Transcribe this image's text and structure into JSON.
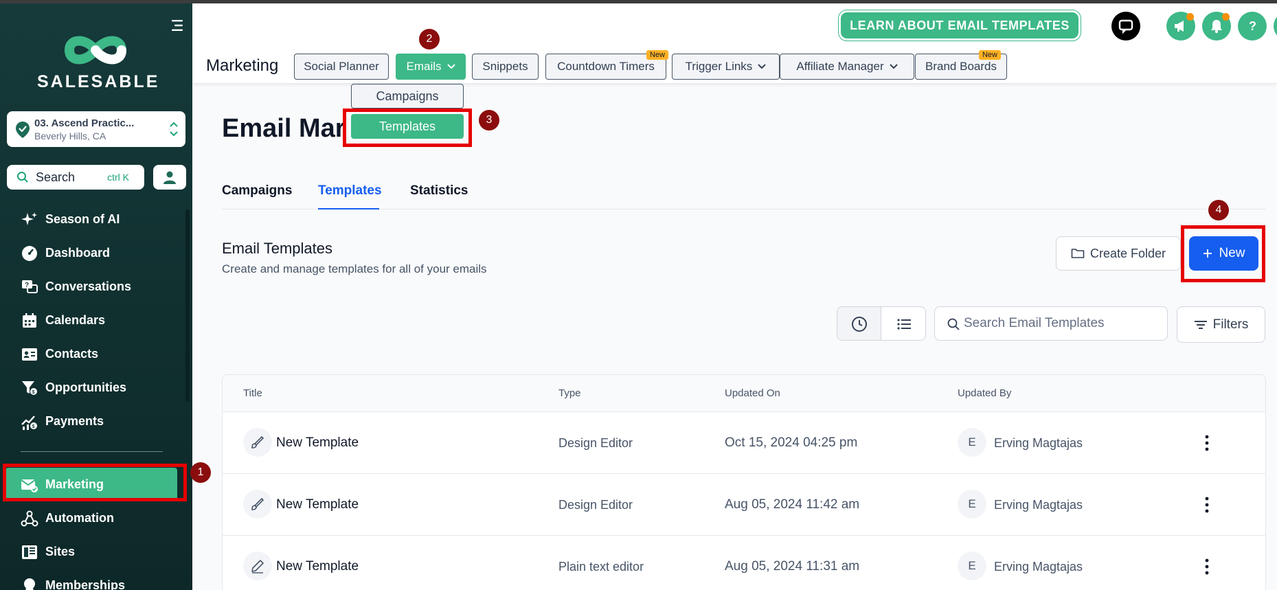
{
  "brand": {
    "name": "SALESABLE",
    "accent": "#3db887",
    "primary": "#155eef",
    "sidebar_bg": "#163a3a",
    "annotation": "#e60000"
  },
  "location": {
    "name": "03. Ascend Practic...",
    "address": "Beverly Hills, CA"
  },
  "sidebar_search": {
    "label": "Search",
    "shortcut": "ctrl K"
  },
  "sidebar": {
    "items": [
      {
        "label": "Season of AI",
        "icon": "sparkles-icon"
      },
      {
        "label": "Dashboard",
        "icon": "gauge-icon"
      },
      {
        "label": "Conversations",
        "icon": "chat-icon"
      },
      {
        "label": "Calendars",
        "icon": "calendar-icon"
      },
      {
        "label": "Contacts",
        "icon": "contact-card-icon"
      },
      {
        "label": "Opportunities",
        "icon": "funnel-icon"
      },
      {
        "label": "Payments",
        "icon": "chart-coin-icon"
      }
    ],
    "items2": [
      {
        "label": "Marketing",
        "icon": "mail-check-icon",
        "active": true
      },
      {
        "label": "Automation",
        "icon": "workflow-icon"
      },
      {
        "label": "Sites",
        "icon": "layout-icon"
      },
      {
        "label": "Memberships",
        "icon": "badge-icon"
      }
    ]
  },
  "header": {
    "learn_button": "LEARN ABOUT EMAIL TEMPLATES"
  },
  "subnav": {
    "title": "Marketing",
    "tabs": [
      {
        "label": "Social Planner"
      },
      {
        "label": "Emails",
        "active": true,
        "dropdown": true
      },
      {
        "label": "Snippets"
      },
      {
        "label": "Countdown Timers",
        "badge": "New"
      },
      {
        "label": "Trigger Links",
        "dropdown": true
      },
      {
        "label": "Affiliate Manager",
        "dropdown": true
      },
      {
        "label": "Brand Boards",
        "badge": "New"
      }
    ]
  },
  "dropdown": {
    "items": [
      "Campaigns",
      "Templates"
    ]
  },
  "markers": [
    "1",
    "2",
    "3",
    "4"
  ],
  "page": {
    "title": "Email Mar",
    "tabs": [
      "Campaigns",
      "Templates",
      "Statistics"
    ],
    "active_tab": "Templates",
    "section_title": "Email Templates",
    "section_subtitle": "Create and manage templates for all of your emails",
    "create_folder": "Create Folder",
    "new_button": "New",
    "search_placeholder": "Search Email Templates",
    "filters": "Filters"
  },
  "table": {
    "columns": [
      "Title",
      "Type",
      "Updated On",
      "Updated By"
    ],
    "rows": [
      {
        "title": "New Template",
        "type": "Design Editor",
        "updated_on": "Oct 15, 2024 04:25 pm",
        "initial": "E",
        "updated_by": "Erving Magtajas"
      },
      {
        "title": "New Template",
        "type": "Design Editor",
        "updated_on": "Aug 05, 2024 11:42 am",
        "initial": "E",
        "updated_by": "Erving Magtajas"
      },
      {
        "title": "New Template",
        "type": "Plain text editor",
        "updated_on": "Aug 05, 2024 11:31 am",
        "initial": "E",
        "updated_by": "Erving Magtajas"
      }
    ]
  }
}
